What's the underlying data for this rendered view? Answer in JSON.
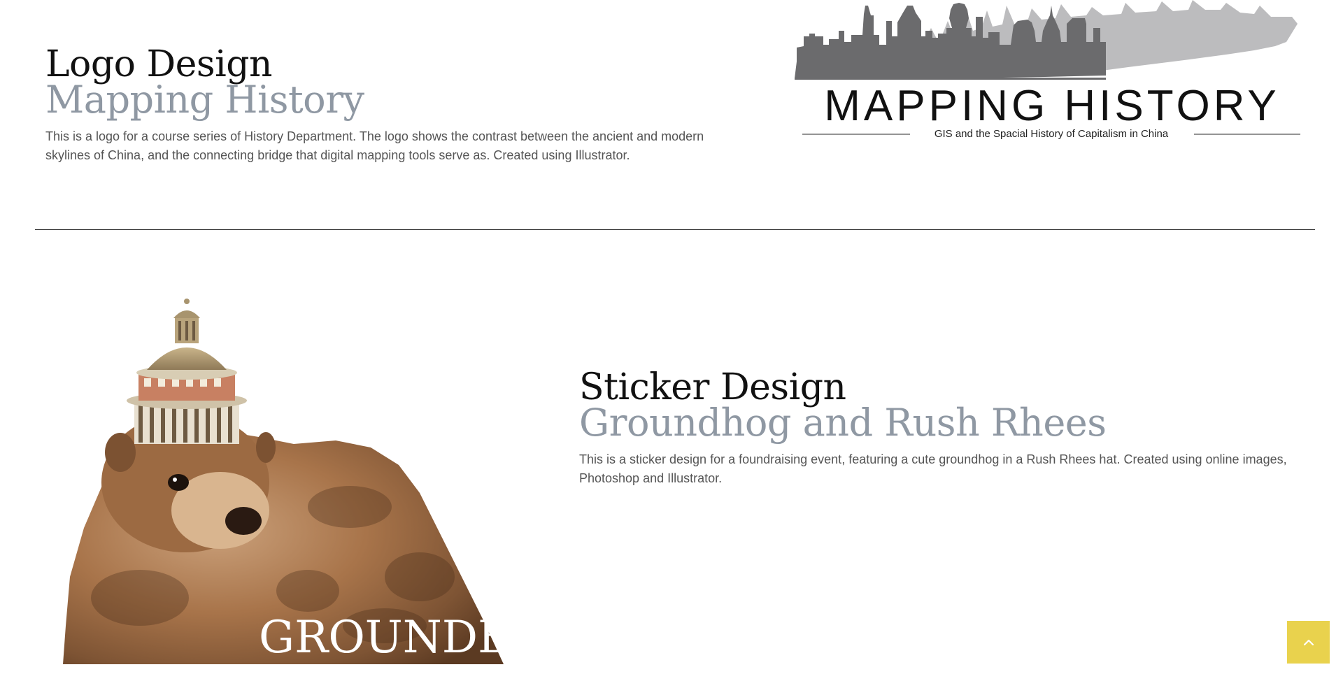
{
  "projects": [
    {
      "category": "Logo Design",
      "title": "Mapping History",
      "description": "This is a logo for a course series of History Department. The logo shows the contrast between the ancient and modern skylines of China, and the connecting bridge that digital mapping tools serve as. Created using Illustrator.",
      "image": {
        "wordmark": "MAPPING HISTORY",
        "tagline": "GIS and the Spacial History of Capitalism in China",
        "skyline_front_color": "#6b6b6d",
        "skyline_back_color": "#bcbcbe"
      }
    },
    {
      "category": "Sticker Design",
      "title": "Groundhog and Rush Rhees",
      "description": "This is a sticker design for a foundraising event, featuring a cute groundhog in a Rush Rhees hat. Created using online images, Photoshop and Illustrator.",
      "image": {
        "wordmark": "GROUNDBOI",
        "fur_color": "#a8744a",
        "dome_color": "#b59a72"
      }
    }
  ],
  "back_to_top": {
    "icon": "chevron-up-icon",
    "color": "#e9d24d"
  }
}
